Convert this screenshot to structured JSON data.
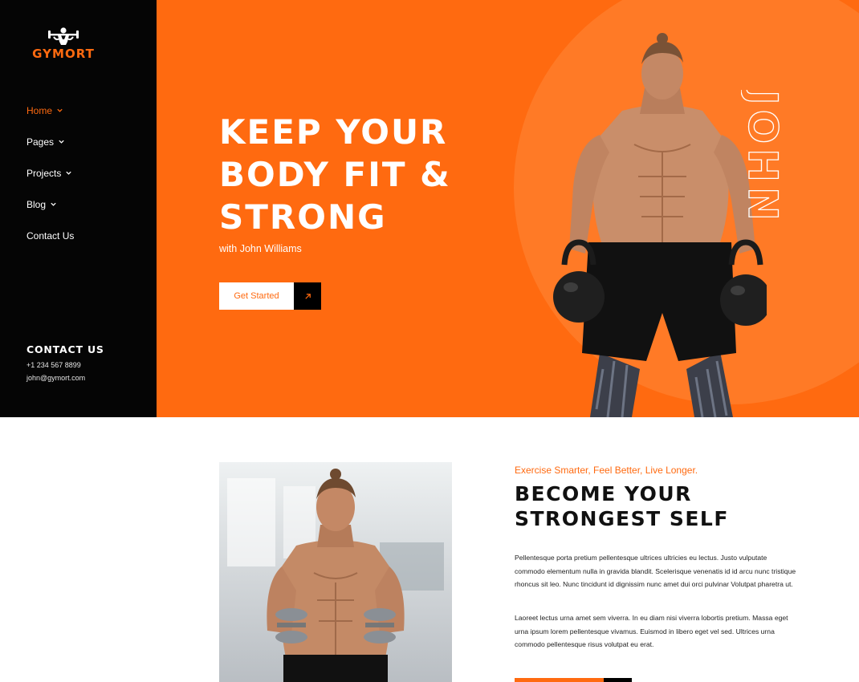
{
  "brand": {
    "name": "GYMORT",
    "accent": "#ff6a10",
    "sidebar_bg": "#050505"
  },
  "sidebar": {
    "nav": [
      {
        "label": "Home",
        "active": true,
        "has_dropdown": true
      },
      {
        "label": "Pages",
        "active": false,
        "has_dropdown": true
      },
      {
        "label": "Projects",
        "active": false,
        "has_dropdown": true
      },
      {
        "label": "Blog",
        "active": false,
        "has_dropdown": true
      },
      {
        "label": "Contact Us",
        "active": false,
        "has_dropdown": false
      }
    ],
    "contact": {
      "title": "CONTACT US",
      "phone": "+1 234 567 8899",
      "email": "john@gymort.com"
    }
  },
  "hero": {
    "title_lines": [
      "KEEP YOUR",
      "BODY FIT &",
      "STRONG"
    ],
    "subtitle": "with John Williams",
    "cta_label": "Get Started",
    "cta_icon": "arrow-up-right-icon",
    "outline_word": "JOHN"
  },
  "about": {
    "tagline": "Exercise Smarter, Feel Better, Live Longer.",
    "title_lines": [
      "BECOME YOUR",
      "STRONGEST SELF"
    ],
    "paragraphs": [
      "Pellentesque porta pretium pellentesque ultrices ultricies eu lectus. Justo vulputate commodo elementum nulla in gravida blandit. Scelerisque venenatis id id arcu nunc tristique rhoncus sit leo. Nunc tincidunt id dignissim nunc amet dui orci pulvinar Volutpat pharetra ut.",
      "Laoreet lectus urna amet sem viverra. In eu diam nisi viverra lobortis pretium. Massa eget urna ipsum lorem pellentesque vivamus. Euismod in libero eget vel sed. Ultrices urna commodo pellentesque risus volutpat eu erat."
    ]
  }
}
